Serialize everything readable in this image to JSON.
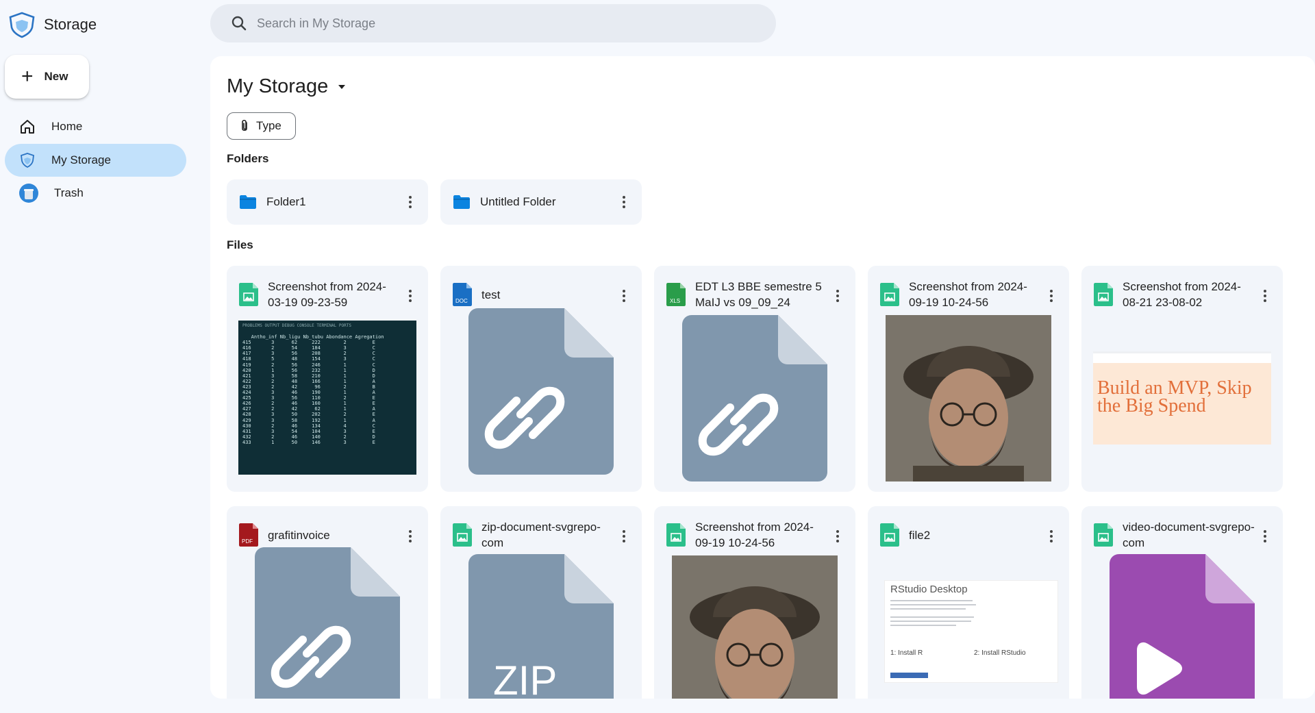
{
  "brand": {
    "name": "Storage"
  },
  "new_button": {
    "label": "New"
  },
  "nav": [
    {
      "label": "Home",
      "icon": "home-icon"
    },
    {
      "label": "My Storage",
      "icon": "storage-icon",
      "active": true
    },
    {
      "label": "Trash",
      "icon": "trash-icon"
    }
  ],
  "search": {
    "placeholder": "Search in My Storage"
  },
  "main": {
    "title": "My Storage",
    "type_filter": "Type",
    "folders_label": "Folders",
    "files_label": "Files"
  },
  "folders": [
    {
      "name": "Folder1"
    },
    {
      "name": "Untitled Folder"
    }
  ],
  "files": [
    {
      "name": "Screenshot from 2024-03-19 09-23-59",
      "type": "image"
    },
    {
      "name": "test",
      "type": "doc",
      "badge": "DOC"
    },
    {
      "name": "EDT L3 BBE semestre 5 MaIJ vs 09_09_24",
      "type": "xls",
      "badge": "XLS"
    },
    {
      "name": "Screenshot from 2024-09-19 10-24-56",
      "type": "image"
    },
    {
      "name": "Screenshot from 2024-08-21 23-08-02",
      "type": "image",
      "preview_text": "Build an MVP, Skip the Big Spend"
    },
    {
      "name": "grafitinvoice",
      "type": "pdf",
      "badge": "PDF"
    },
    {
      "name": "zip-document-svgrepo-com",
      "type": "image",
      "preview_text": "ZIP"
    },
    {
      "name": "Screenshot from 2024-09-19 10-24-56",
      "type": "image"
    },
    {
      "name": "file2",
      "type": "image",
      "preview_title": "RStudio Desktop",
      "preview_steps": [
        "1: Install R",
        "2: Install RStudio"
      ]
    },
    {
      "name": "video-document-svgrepo-com",
      "type": "image"
    }
  ],
  "terminal_preview": {
    "tabs": "PROBLEMS   OUTPUT   DEBUG CONSOLE   TERMINAL   PORTS",
    "text": "   Antho_inf Nb_ligu Nb_tubu Abondance Agregation\n415       3      62     222        2         E\n416       2      54     184        3         C\n417       3      56     208        2         C\n418       5      48     154        3         C\n419       2      56     246        1         C\n420       1      56     232        1         D\n421       3      58     210        1         D\n422       2      48     166        1         A\n423       2      42      96        2         B\n424       3      46     190        1         A\n425       3      56     110        2         E\n426       2      46     160        1         E\n427       2      42      62        1         A\n428       3      50     202        2         E\n429       3      58     192        1         A\n430       2      46     134        4         C\n431       3      54     104        3         E\n432       2      46     140        2         D\n433       1      50     146        3         E"
  },
  "colors": {
    "accent": "#c2e1fb",
    "folder": "#0b84e0",
    "image_file": "#2bbf8a",
    "doc_file": "#1a6fc4",
    "xls_file": "#2a9d4a",
    "pdf_file": "#a4191e",
    "generic_doc": "#8097ad",
    "video_doc": "#9b4bb0"
  }
}
